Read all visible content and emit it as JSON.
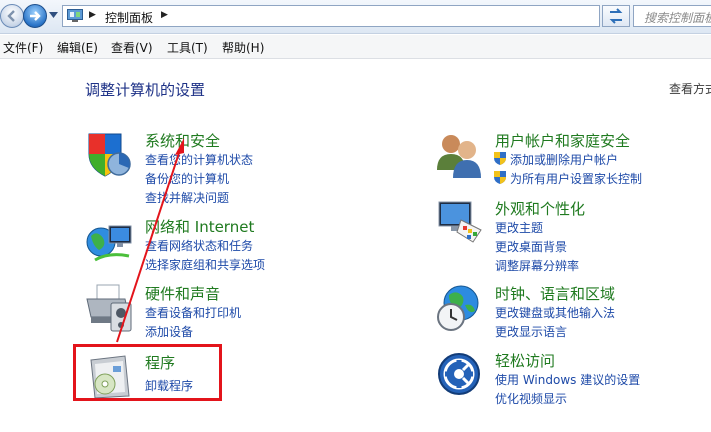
{
  "window": {
    "address": {
      "path": "控制面板",
      "separator": "▶"
    },
    "search": {
      "placeholder": "搜索控制面板"
    }
  },
  "menu": {
    "items": [
      "文件(F)",
      "编辑(E)",
      "查看(V)",
      "工具(T)",
      "帮助(H)"
    ]
  },
  "main": {
    "title": "调整计算机的设置",
    "view_by": "查看方式"
  },
  "categories": [
    {
      "title": "系统和安全",
      "icon": "shield-icon",
      "links": [
        "查看您的计算机状态",
        "备份您的计算机",
        "查找并解决问题"
      ]
    },
    {
      "title": "网络和 Internet",
      "icon": "network-icon",
      "links": [
        "查看网络状态和任务",
        "选择家庭组和共享选项"
      ]
    },
    {
      "title": "硬件和声音",
      "icon": "printer-icon",
      "links": [
        "查看设备和打印机",
        "添加设备"
      ]
    },
    {
      "title": "程序",
      "icon": "programs-icon",
      "links": [
        "卸载程序"
      ]
    },
    {
      "title": "用户帐户和家庭安全",
      "icon": "users-icon",
      "links": [
        "添加或删除用户帐户",
        "为所有用户设置家长控制"
      ]
    },
    {
      "title": "外观和个性化",
      "icon": "monitor-palette-icon",
      "links": [
        "更改主题",
        "更改桌面背景",
        "调整屏幕分辨率"
      ]
    },
    {
      "title": "时钟、语言和区域",
      "icon": "globe-clock-icon",
      "links": [
        "更改键盘或其他输入法",
        "更改显示语言"
      ]
    },
    {
      "title": "轻松访问",
      "icon": "ease-of-access-icon",
      "links": [
        "使用 Windows 建议的设置",
        "优化视频显示"
      ]
    }
  ],
  "colors": {
    "category_title": "#1f7a1f",
    "link": "#1e4aa8",
    "page_title": "#1e3287",
    "annotation": "#e3141b"
  }
}
